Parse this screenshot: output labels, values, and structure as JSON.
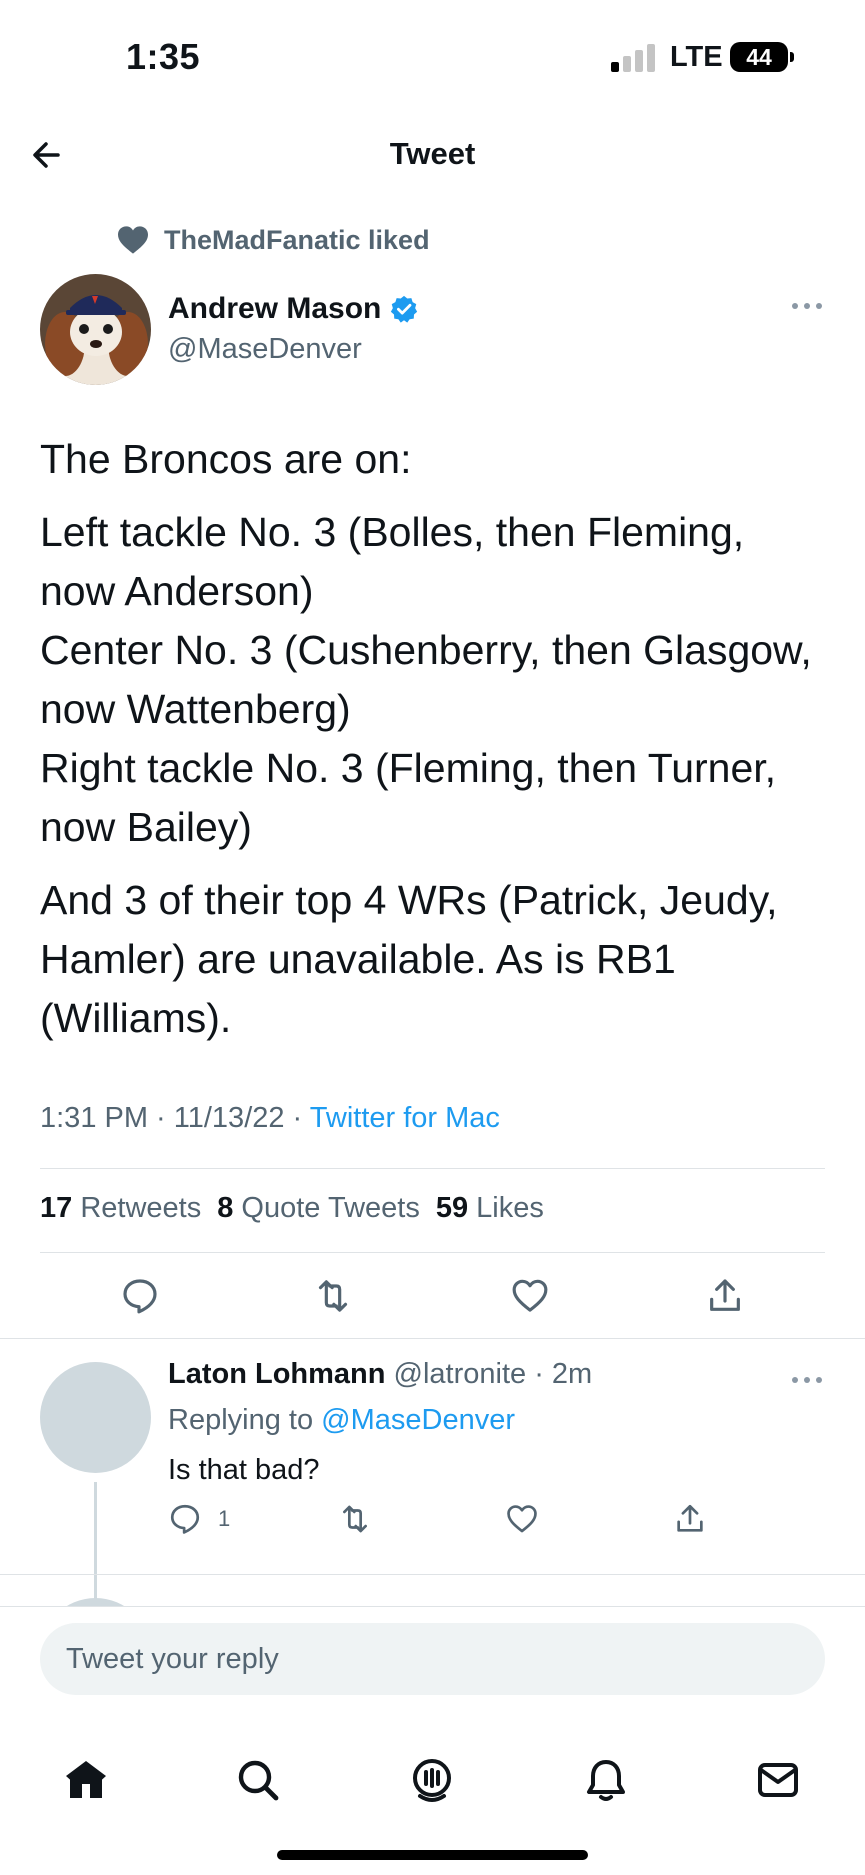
{
  "status_bar": {
    "time": "1:35",
    "network": "LTE",
    "battery": "44"
  },
  "header": {
    "title": "Tweet",
    "back_icon": "arrow-left-icon"
  },
  "social_context": {
    "icon": "heart-icon",
    "text": "TheMadFanatic liked"
  },
  "tweet": {
    "author_name": "Andrew Mason",
    "verified": true,
    "author_handle": "@MaseDenver",
    "paragraphs": [
      "The Broncos are on:",
      "Left tackle No. 3 (Bolles, then Fleming, now Anderson)\nCenter No. 3 (Cushenberry, then Glasgow, now Wattenberg)\nRight tackle No. 3 (Fleming, then Turner, now Bailey)",
      "And 3 of their top 4 WRs (Patrick, Jeudy, Hamler) are unavailable. As is RB1 (Williams)."
    ],
    "timestamp": "1:31 PM · 11/13/22 · ",
    "source": "Twitter for Mac",
    "stats": {
      "retweets_count": "17",
      "retweets_label": "Retweets",
      "quotes_count": "8",
      "quotes_label": "Quote Tweets",
      "likes_count": "59",
      "likes_label": "Likes"
    }
  },
  "reply": {
    "name": "Laton Lohmann",
    "handle_time": "@latronite · 2m",
    "replying_prefix": "Replying to ",
    "replying_to": "@MaseDenver",
    "text": "Is that bad?",
    "reply_count": "1"
  },
  "composer": {
    "placeholder": "Tweet your reply"
  },
  "tabs": [
    "home-icon",
    "search-icon",
    "spaces-icon",
    "notifications-icon",
    "messages-icon"
  ],
  "colors": {
    "accent": "#1d9bf0",
    "secondary_text": "#536471",
    "divider": "#dfe3e6"
  }
}
